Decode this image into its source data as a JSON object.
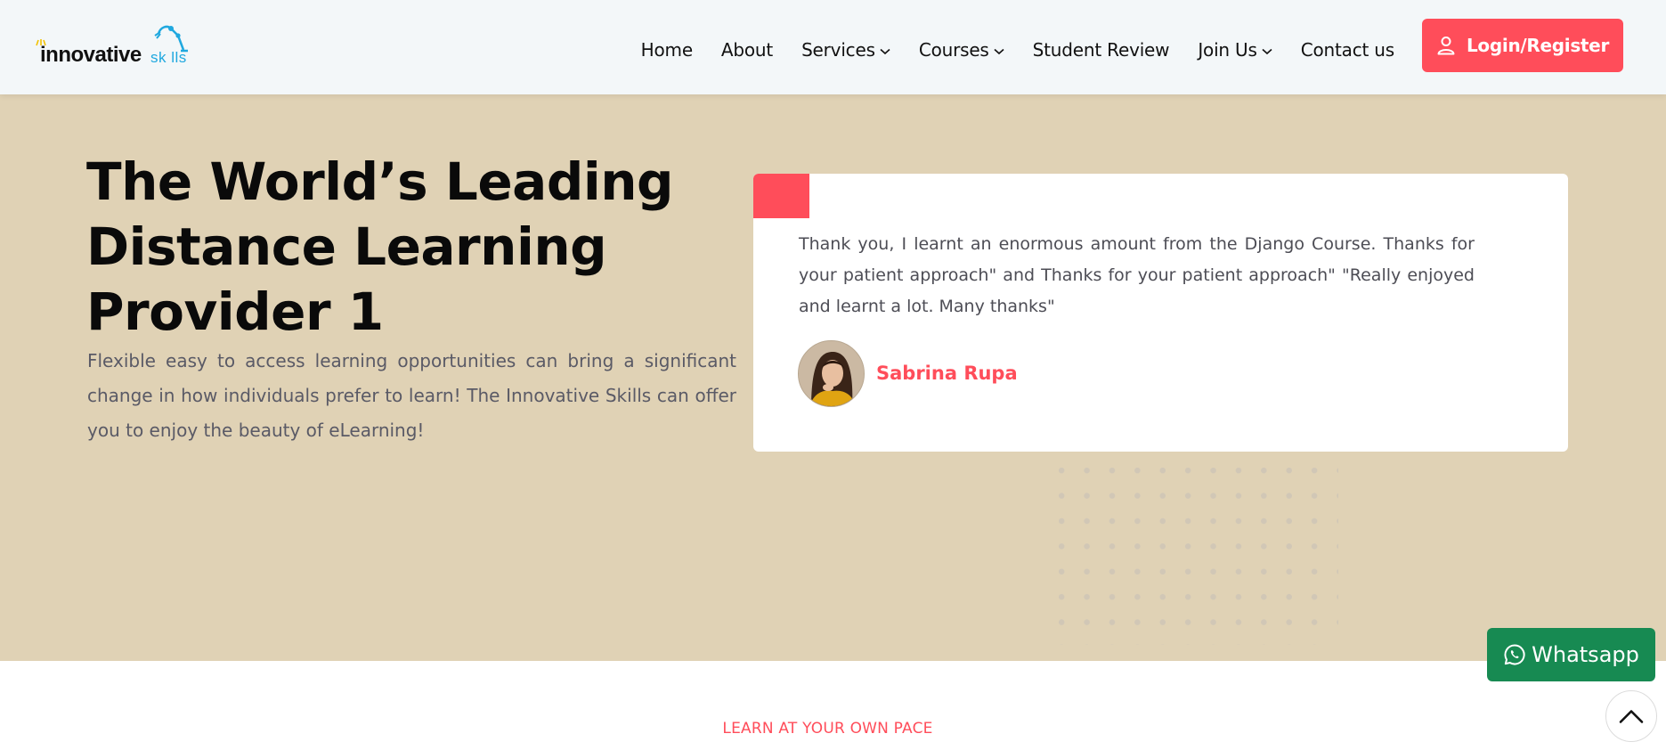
{
  "header": {
    "logo": {
      "text_main": "innovative",
      "text_skills": "sk lls",
      "name": "Innovative Skills"
    },
    "nav": [
      {
        "label": "Home",
        "has_dropdown": false
      },
      {
        "label": "About",
        "has_dropdown": false
      },
      {
        "label": "Services",
        "has_dropdown": true
      },
      {
        "label": "Courses",
        "has_dropdown": true
      },
      {
        "label": "Student Review",
        "has_dropdown": false
      },
      {
        "label": "Join Us",
        "has_dropdown": true
      },
      {
        "label": "Contact us",
        "has_dropdown": false
      }
    ],
    "login_label": "Login/Register",
    "login_icon": "user-icon"
  },
  "hero": {
    "title": "The World’s Leading Distance Learning Provider 1",
    "description": "Flexible easy to access learning opportunities can bring a significant change in how individuals prefer to learn! The Innovative Skills can offer you to enjoy the beauty of eLearning!",
    "testimonial": {
      "quote": "Thank you, I learnt an enormous amount from the Django Course. Thanks for your patient approach\" and Thanks for your patient approach\" \"Really enjoyed and learnt a lot. Many thanks\"",
      "reviewer_name": "Sabrina Rupa"
    }
  },
  "floating": {
    "whatsapp_label": "Whatsapp",
    "whatsapp_icon": "whatsapp-icon",
    "scroll_top_icon": "chevron-up-icon"
  },
  "section": {
    "kicker": "LEARN AT YOUR OWN PACE"
  },
  "colors": {
    "accent": "#ff4d5a",
    "hero_bg": "#e0d2b5",
    "header_bg": "#f3f7f9",
    "whatsapp": "#178a52",
    "logo_blue": "#1fa8df"
  }
}
